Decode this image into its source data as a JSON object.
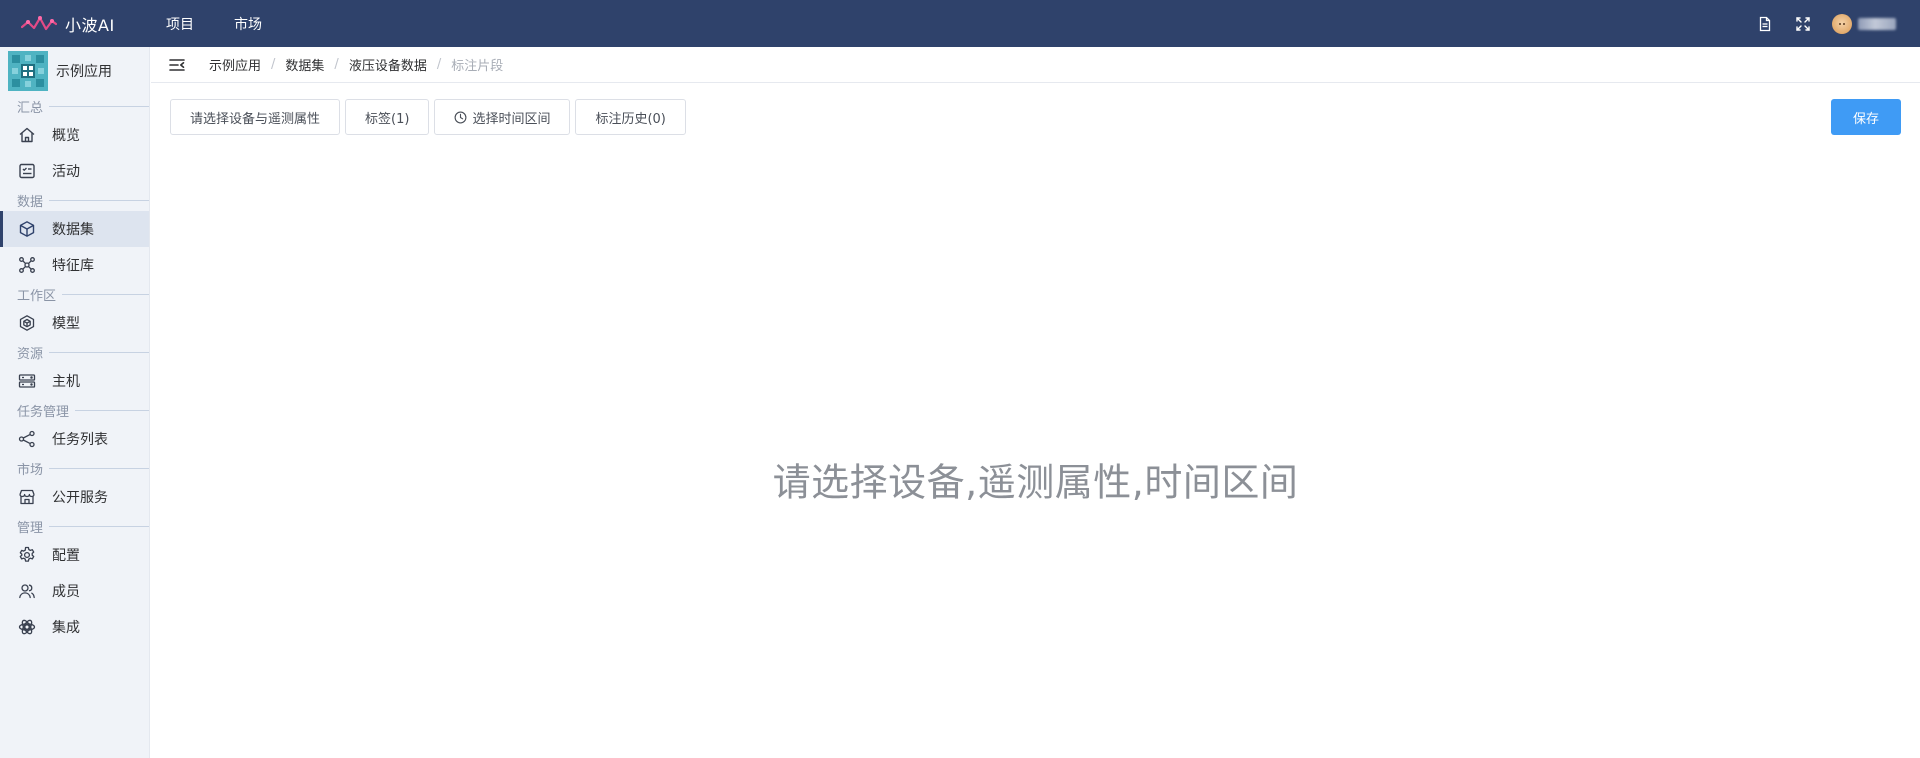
{
  "topbar": {
    "brand": "小波AI",
    "nav": [
      "项目",
      "市场"
    ],
    "icons": [
      "document-icon",
      "fullscreen-icon"
    ]
  },
  "sidebar": {
    "app_name": "示例应用",
    "groups": [
      {
        "title": "汇总",
        "items": [
          {
            "icon": "home-icon",
            "label": "概览"
          },
          {
            "icon": "activity-icon",
            "label": "活动"
          }
        ]
      },
      {
        "title": "数据",
        "items": [
          {
            "icon": "cube-icon",
            "label": "数据集",
            "active": true
          },
          {
            "icon": "feature-network-icon",
            "label": "特征库"
          }
        ]
      },
      {
        "title": "工作区",
        "items": [
          {
            "icon": "model-box-icon",
            "label": "模型"
          }
        ]
      },
      {
        "title": "资源",
        "items": [
          {
            "icon": "server-icon",
            "label": "主机"
          }
        ]
      },
      {
        "title": "任务管理",
        "items": [
          {
            "icon": "workflow-icon",
            "label": "任务列表"
          }
        ]
      },
      {
        "title": "市场",
        "items": [
          {
            "icon": "storefront-icon",
            "label": "公开服务"
          }
        ]
      },
      {
        "title": "管理",
        "items": [
          {
            "icon": "gear-icon",
            "label": "配置"
          },
          {
            "icon": "users-icon",
            "label": "成员"
          },
          {
            "icon": "integration-icon",
            "label": "集成"
          }
        ]
      }
    ]
  },
  "breadcrumb": [
    "示例应用",
    "数据集",
    "液压设备数据",
    "标注片段"
  ],
  "toolbar": {
    "select_device": "请选择设备与遥测属性",
    "tags": "标签(1)",
    "time_range": "选择时间区间",
    "history": "标注历史(0)",
    "save": "保存"
  },
  "empty_state": "请选择设备,遥测属性,时间区间",
  "colors": {
    "topbar": "#2f426b",
    "primary": "#3f9bf5",
    "sidebar_bg": "#f0f3f8",
    "sidebar_active": "#dde4ef",
    "brand_logo": "#e24a86"
  }
}
